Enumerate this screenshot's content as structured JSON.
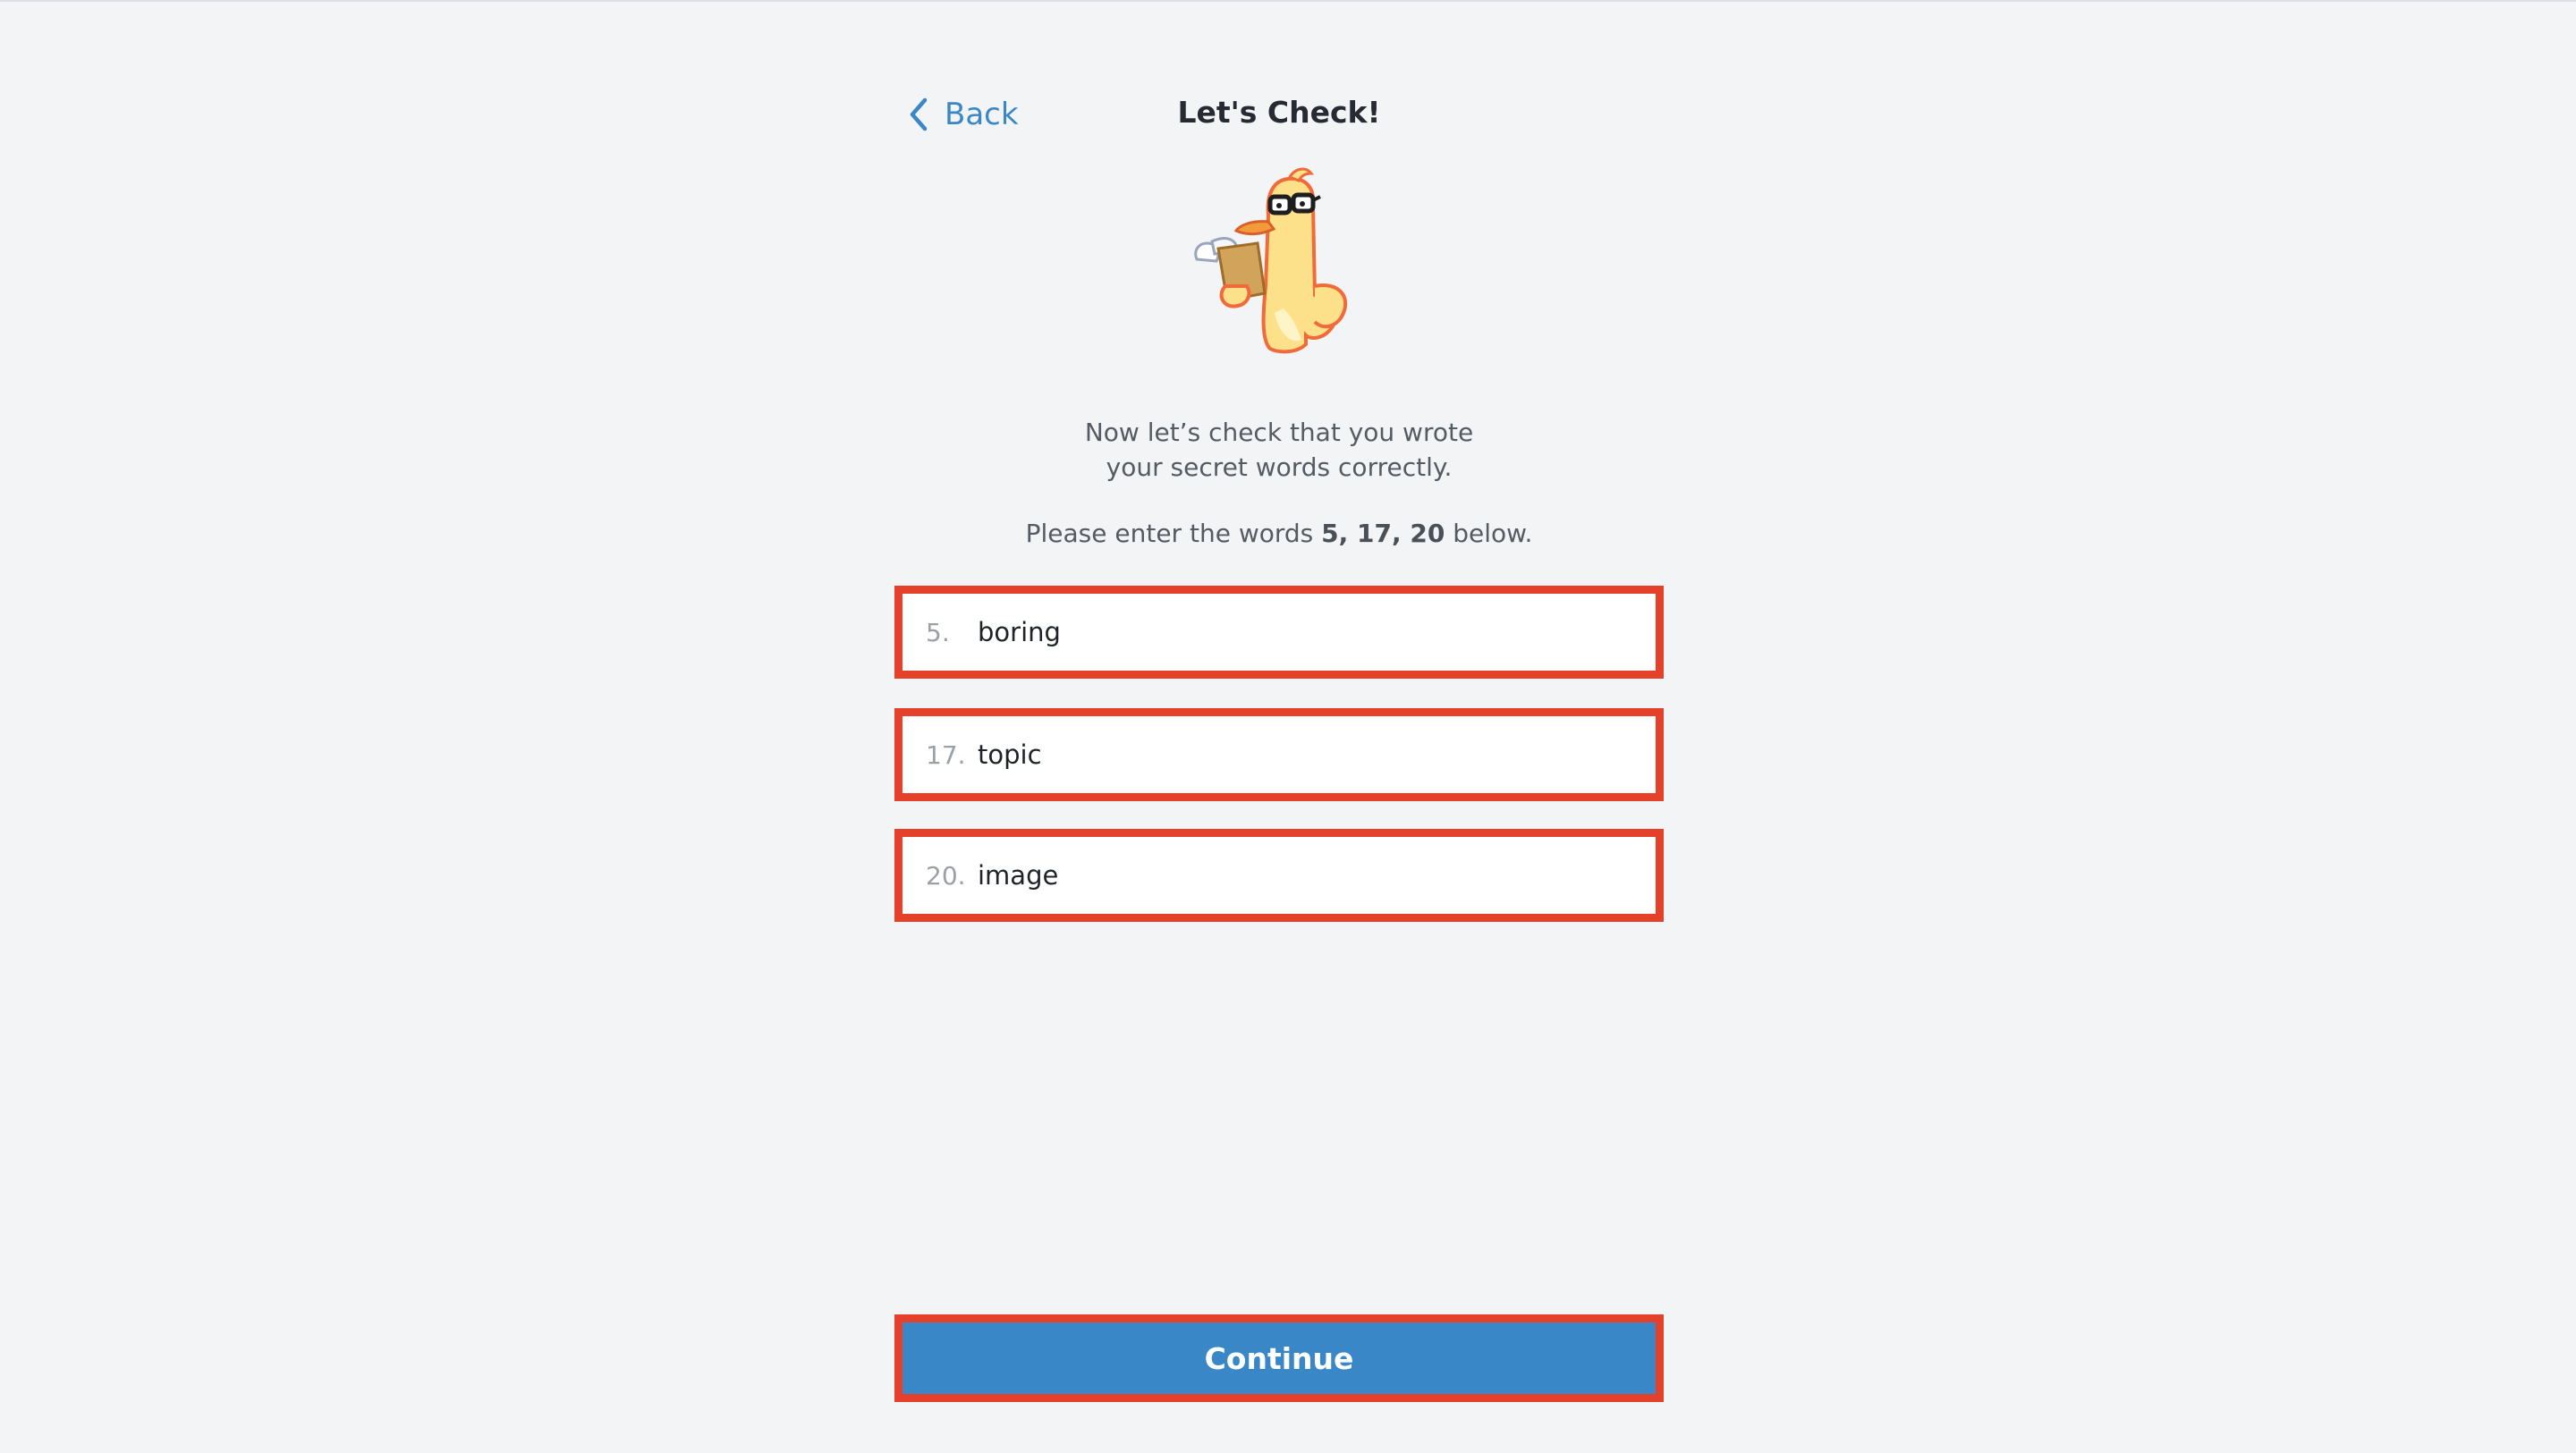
{
  "header": {
    "back_label": "Back",
    "title": "Let's Check!"
  },
  "mascot": {
    "icon": "duck-with-glasses-notepad-icon"
  },
  "description": {
    "line1": "Now let’s check that you wrote",
    "line2": "your secret words correctly."
  },
  "prompt": {
    "prefix": "Please enter the words ",
    "words": "5, 17, 20",
    "suffix": " below."
  },
  "fields": [
    {
      "number": "5.",
      "value": "boring"
    },
    {
      "number": "17.",
      "value": "topic"
    },
    {
      "number": "20.",
      "value": "image"
    }
  ],
  "continue_label": "Continue",
  "colors": {
    "accent": "#3a87c7",
    "highlight": "#e5402a",
    "background": "#f2f4f6"
  }
}
